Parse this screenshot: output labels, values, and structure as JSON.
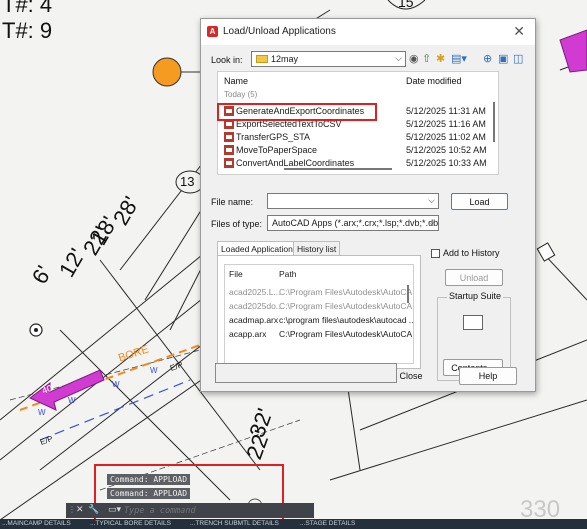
{
  "drawing": {
    "top_left_text_1": "T#: 4",
    "top_left_text_2": "T#: 9",
    "bubble_label_top": "15",
    "bubble_label_left": "13",
    "dims_upper": [
      "28'",
      "18'",
      "22'",
      "12'",
      "6'"
    ],
    "dims_lower": [
      "32'",
      "22'"
    ],
    "bore_label": "BORE",
    "line_marks": [
      "W",
      "W",
      "W",
      "W"
    ],
    "ep_labels": [
      "E/P",
      "E/P"
    ],
    "arrow_label": "40'",
    "corner_number": "330"
  },
  "dialog": {
    "title": "Load/Unload Applications",
    "close_label": "✕",
    "look_in_label": "Look in:",
    "look_in_value": "12may",
    "columns": {
      "name": "Name",
      "date": "Date modified"
    },
    "group_header": "Today (5)",
    "files": [
      {
        "name": "GenerateAndExportCoordinates",
        "date": "5/12/2025 11:31 AM"
      },
      {
        "name": "ExportSelectedTextToCSV",
        "date": "5/12/2025 11:16 AM"
      },
      {
        "name": "TransferGPS_STA",
        "date": "5/12/2025 11:02 AM"
      },
      {
        "name": "MoveToPaperSpace",
        "date": "5/12/2025 10:52 AM"
      },
      {
        "name": "ConvertAndLabelCoordinates",
        "date": "5/12/2025 10:33 AM"
      }
    ],
    "file_name_label": "File name:",
    "file_name_value": "",
    "load_button": "Load",
    "files_of_type_label": "Files of type:",
    "files_of_type_value": "AutoCAD Apps (*.arx;*.crx;*.lsp;*.dvb;*.dbx;*.",
    "tabs": [
      "Loaded Applications",
      "History list"
    ],
    "loaded_columns": {
      "file": "File",
      "path": "Path"
    },
    "loaded_apps": [
      {
        "file": "acad2025.L...",
        "path": "C:\\Program Files\\Autodesk\\AutoCA...",
        "muted": true
      },
      {
        "file": "acad2025do...",
        "path": "C:\\Program Files\\Autodesk\\AutoCA...",
        "muted": true
      },
      {
        "file": "acadmap.arx",
        "path": "c:\\program files\\autodesk\\autocad ...",
        "muted": false
      },
      {
        "file": "acapp.arx",
        "path": "C:\\Program Files\\Autodesk\\AutoCA...",
        "muted": false
      }
    ],
    "add_to_history_label": "Add to History",
    "unload_button": "Unload",
    "startup_suite_label": "Startup Suite",
    "contents_button": "Contents...",
    "close_button": "Close",
    "help_button": "Help"
  },
  "command_line": {
    "history": [
      "Command: APPLOAD",
      "Command: APPLOAD"
    ],
    "placeholder": "Type a command",
    "close_icon": "✕"
  },
  "status_bar": {
    "tabs": [
      "...MAINCAMP DETAILS",
      "...TYPICAL BORE DETAILS",
      "...TRENCH SUBMTL DETAILS",
      "...STAGE DETAILS"
    ]
  }
}
